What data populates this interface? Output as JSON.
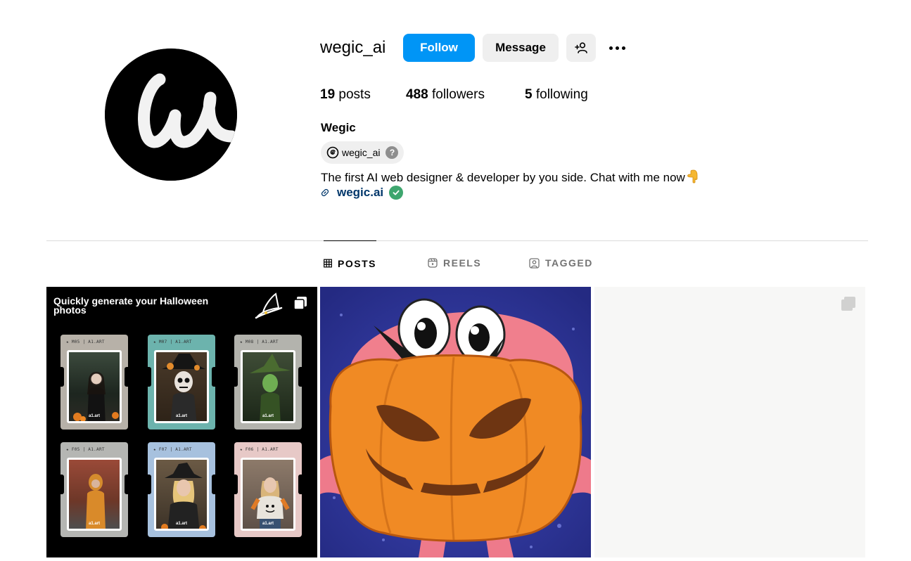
{
  "profile": {
    "username": "wegic_ai",
    "full_name": "Wegic",
    "threads_handle": "wegic_ai",
    "threads_help": "?",
    "bio": "The first AI web designer & developer by you side. Chat with me now",
    "website": "wegic.ai"
  },
  "actions": {
    "follow_label": "Follow",
    "message_label": "Message"
  },
  "stats": {
    "posts_count": "19",
    "posts_label": "posts",
    "followers_count": "488",
    "followers_label": "followers",
    "following_count": "5",
    "following_label": "following"
  },
  "tabs": [
    {
      "label": "POSTS",
      "icon": "grid-icon",
      "active": true
    },
    {
      "label": "REELS",
      "icon": "reels-icon",
      "active": false
    },
    {
      "label": "TAGGED",
      "icon": "tagged-icon",
      "active": false
    }
  ],
  "posts": {
    "post1": {
      "title": "Quickly generate your Halloween photos",
      "cards": [
        {
          "label": "★ M05 | A1.ART",
          "brand": "a1.art"
        },
        {
          "label": "★ M07 | A1.ART",
          "brand": "a1.art"
        },
        {
          "label": "★ M08 | A1.ART",
          "brand": "a1.art"
        },
        {
          "label": "★ F05 | A1.ART",
          "brand": "a1.art"
        },
        {
          "label": "★ F07 | A1.ART",
          "brand": "a1.art"
        },
        {
          "label": "★ F06 | A1.ART",
          "brand": "a1.art"
        }
      ]
    }
  },
  "colors": {
    "follow_button": "#0095f6",
    "secondary_button": "#efefef",
    "link": "#00376b",
    "verified": "#3ea66e",
    "divider": "#dbdbdb"
  }
}
